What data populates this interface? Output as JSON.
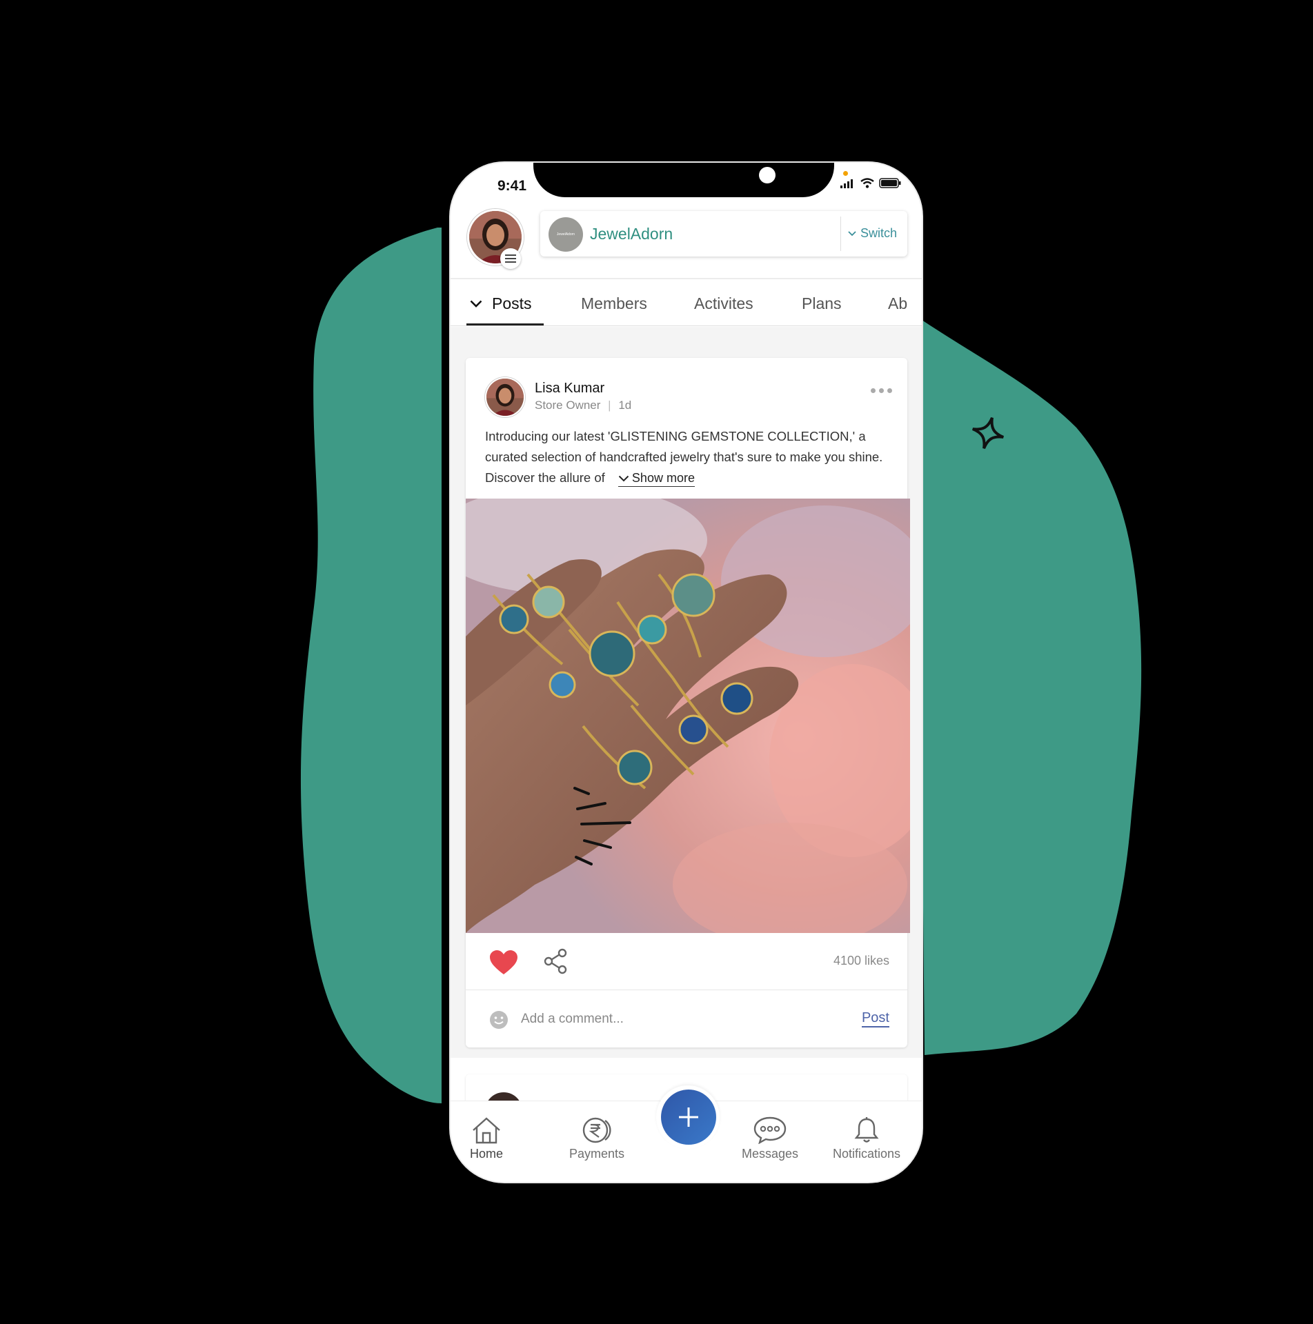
{
  "status_bar": {
    "time": "9:41"
  },
  "header": {
    "org_name": "JewelAdorn",
    "org_logo_text": "JewelAdorn",
    "switch_label": "Switch"
  },
  "tabs": [
    {
      "label": "Posts",
      "active": true
    },
    {
      "label": "Members",
      "active": false
    },
    {
      "label": "Activites",
      "active": false
    },
    {
      "label": "Plans",
      "active": false
    },
    {
      "label": "Ab",
      "active": false
    }
  ],
  "post": {
    "author": "Lisa Kumar",
    "role": "Store Owner",
    "separator": "|",
    "age": "1d",
    "text": "Introducing our latest 'GLISTENING GEMSTONE COLLECTION,' a curated selection of handcrafted jewelry that's sure to make you shine. Discover the allure of",
    "show_more_label": "Show more",
    "likes": "4100 likes",
    "liked": true,
    "comment_placeholder": "Add a comment...",
    "post_button_label": "Post"
  },
  "bottom_nav": {
    "items": [
      {
        "label": "Home",
        "icon": "home-icon"
      },
      {
        "label": "Payments",
        "icon": "rupee-coin-icon"
      },
      {
        "label": "Messages",
        "icon": "chat-bubble-icon"
      },
      {
        "label": "Notifications",
        "icon": "bell-icon"
      }
    ],
    "fab_icon": "plus-icon"
  },
  "colors": {
    "brand_teal": "#3e9a86",
    "org_name": "#2f8f80",
    "heart": "#e8474f",
    "fab": "#2f5fae",
    "post_link": "#4d63a8"
  }
}
